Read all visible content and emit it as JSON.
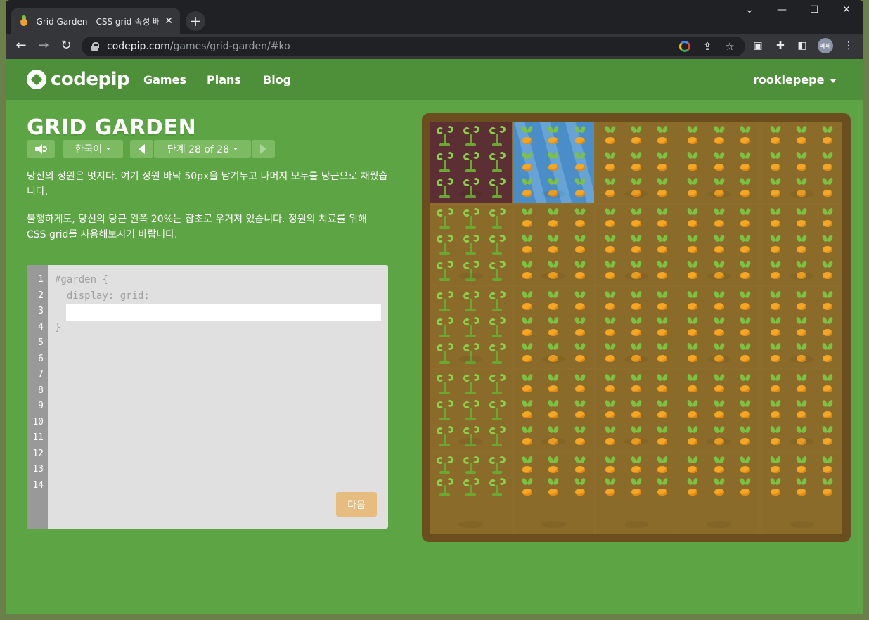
{
  "browser": {
    "tab_title": "Grid Garden - CSS grid 속성 배우기",
    "tab_close": "✕",
    "new_tab": "+",
    "url_host": "codepip.com",
    "url_path": "/games/grid-garden/#ko",
    "profile_label": "페페",
    "window_controls": [
      "⌄",
      "—",
      "☐",
      "✕"
    ]
  },
  "site": {
    "logo_text": "codepip",
    "nav": [
      "Games",
      "Plans",
      "Blog"
    ],
    "user": "rookiepepe"
  },
  "level": {
    "title": "GRID GARDEN",
    "language": "한국어",
    "indicator": "단계 28 of 28"
  },
  "instructions": [
    "당신의 정원은 멋지다. 여기 정원 바닥 50px을 남겨두고 나머지 모두를 당근으로 채웠습니다.",
    "불행하게도, 당신의 당근 왼쪽 20%는 잡초로 우거져 있습니다. 정원의 치료를 위해 CSS grid를 사용해보시기 바랍니다."
  ],
  "editor": {
    "line_numbers": [
      "1",
      "2",
      "3",
      "4",
      "5",
      "6",
      "7",
      "8",
      "9",
      "10",
      "11",
      "12",
      "13",
      "14"
    ],
    "code_before": [
      "#garden {",
      "  display: grid;"
    ],
    "code_after": [
      "}"
    ],
    "input_value": "",
    "next_label": "다음"
  },
  "garden": {
    "columns": 5,
    "rows": 5,
    "poison_cell": "row 1, col 1",
    "water_cell": "row 1, col 2",
    "weed_column": 1,
    "empty_bottom": "50px"
  },
  "icons": [
    "sound-icon",
    "prev-level-icon",
    "next-level-icon",
    "lock-icon",
    "google-icon",
    "share-icon",
    "star-icon",
    "camera-icon",
    "extensions-icon",
    "sidepanel-icon",
    "menu-icon"
  ],
  "colors": {
    "page_green": "#5da444",
    "nav_green": "#4e8f3a",
    "button_green": "#7cbb62",
    "next_button": "#e6bd7e",
    "soil": "#8a6b2a",
    "frame": "#6b4e1e"
  }
}
